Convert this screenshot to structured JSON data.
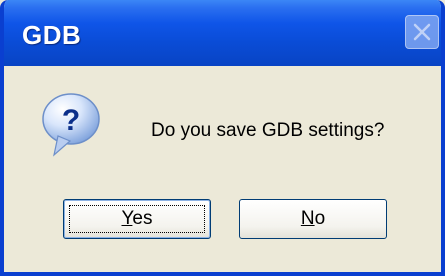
{
  "window": {
    "title": "GDB",
    "close_icon": "close-icon"
  },
  "dialog": {
    "icon": "question-icon",
    "message": "Do you save GDB settings?"
  },
  "buttons": {
    "yes": {
      "mnemonic": "Y",
      "rest": "es"
    },
    "no": {
      "mnemonic": "N",
      "rest": "o"
    }
  },
  "colors": {
    "titlebar": "#0a4cd6",
    "dialog_bg": "#ece9d8"
  }
}
